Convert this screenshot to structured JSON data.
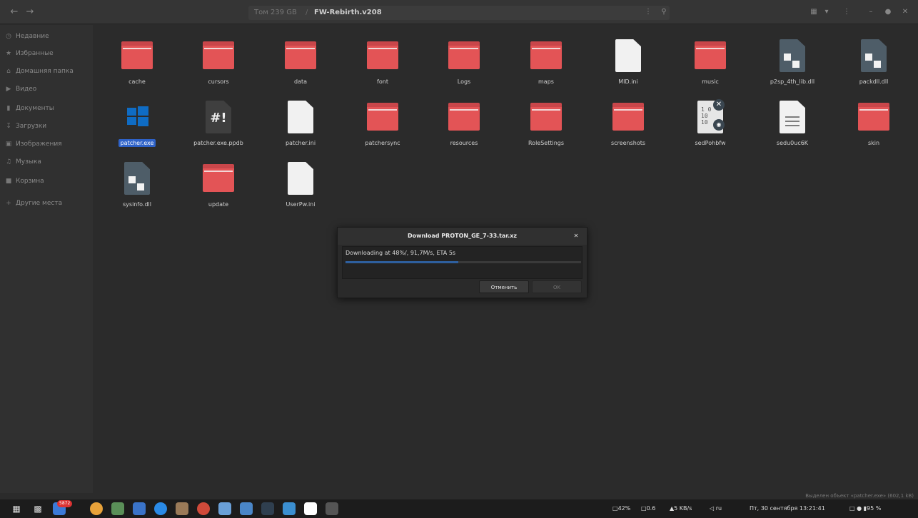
{
  "headerbar": {
    "back_icon": "arrow-left",
    "forward_icon": "arrow-right",
    "path_root": "Том 239 GB",
    "path_sep": "/",
    "path_current": "FW-Rebirth.v208"
  },
  "sidebar": {
    "items": [
      {
        "label": "Недавние",
        "icon": "clock"
      },
      {
        "label": "Избранные",
        "icon": "star"
      },
      {
        "label": "Домашняя папка",
        "icon": "home"
      },
      {
        "label": "Видео",
        "icon": "video"
      },
      {
        "label": "Документы",
        "icon": "document"
      },
      {
        "label": "Загрузки",
        "icon": "download"
      },
      {
        "label": "Изображения",
        "icon": "image"
      },
      {
        "label": "Музыка",
        "icon": "music"
      },
      {
        "label": "Корзина",
        "icon": "trash"
      },
      {
        "label": "Другие места",
        "icon": "plus"
      }
    ]
  },
  "files": [
    {
      "name": "cache",
      "type": "folder"
    },
    {
      "name": "cursors",
      "type": "folder"
    },
    {
      "name": "data",
      "type": "folder"
    },
    {
      "name": "font",
      "type": "folder"
    },
    {
      "name": "Logs",
      "type": "folder"
    },
    {
      "name": "maps",
      "type": "folder"
    },
    {
      "name": "MID.ini",
      "type": "doc"
    },
    {
      "name": "music",
      "type": "folder"
    },
    {
      "name": "p2sp_4th_lib.dll",
      "type": "dll"
    },
    {
      "name": "packdll.dll",
      "type": "dll"
    },
    {
      "name": "patcher.exe",
      "type": "exe",
      "selected": true
    },
    {
      "name": "patcher.exe.ppdb",
      "type": "script"
    },
    {
      "name": "patcher.ini",
      "type": "doc"
    },
    {
      "name": "patchersync",
      "type": "folder"
    },
    {
      "name": "resources",
      "type": "folder"
    },
    {
      "name": "RoleSettings",
      "type": "folder"
    },
    {
      "name": "screenshots",
      "type": "folder"
    },
    {
      "name": "sedPohbfw",
      "type": "binary"
    },
    {
      "name": "sedu0uc6K",
      "type": "text"
    },
    {
      "name": "skin",
      "type": "folder"
    },
    {
      "name": "sysinfo.dll",
      "type": "dll"
    },
    {
      "name": "update",
      "type": "folder"
    },
    {
      "name": "UserPw.ini",
      "type": "doc"
    }
  ],
  "dialog": {
    "title": "Download PROTON_GE_7-33.tar.xz",
    "close_icon": "close",
    "status": "Downloading at 48%/, 91,7M/s, ETA 5s",
    "progress": 0.48,
    "cancel_label": "Отменить",
    "ok_label": "OK"
  },
  "statusbar": {
    "text": "Выделен объект «patcher.exe» (602,1 kB)"
  },
  "taskbar": {
    "badge": "5872",
    "tray": {
      "cpu": "42%",
      "load": "0.6",
      "net": "5 KB/s",
      "lang": "ru",
      "datetime": "Пт, 30 сентября 13:21:41",
      "battery": "95 %"
    }
  },
  "colors": {
    "folder": "#e35456",
    "selection": "#2e62c8",
    "progress": "#2e5f9e"
  }
}
